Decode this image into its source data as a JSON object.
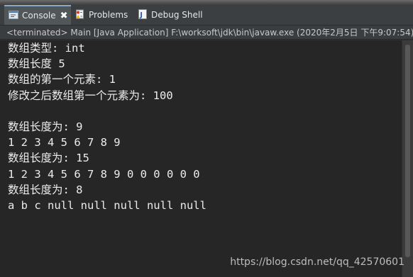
{
  "tabs": [
    {
      "label": "Console",
      "icon": "console-icon",
      "active": true,
      "close_symbol": "✖"
    },
    {
      "label": "Problems",
      "icon": "problems-icon",
      "active": false
    },
    {
      "label": "Debug Shell",
      "icon": "debug-shell-icon",
      "active": false
    }
  ],
  "status_line": "<terminated> Main [Java Application] F:\\worksoft\\jdk\\bin\\javaw.exe (2020年2月5日 下午9:07:54)",
  "console_lines": [
    "数组类型: int",
    "数组长度 5",
    "数组的第一个元素: 1",
    "修改之后数组第一个元素为: 100",
    "",
    "数组长度为: 9",
    "1 2 3 4 5 6 7 8 9",
    "数组长度为: 15",
    "1 2 3 4 5 6 7 8 9 0 0 0 0 0 0",
    "数组长度为: 8",
    "a b c null null null null null"
  ],
  "watermark": "https://blog.csdn.net/qq_42570601",
  "colors": {
    "console_background": "#262626",
    "console_text": "#ececec",
    "tab_bar": "#3c3f41",
    "active_tab": "#515658"
  }
}
